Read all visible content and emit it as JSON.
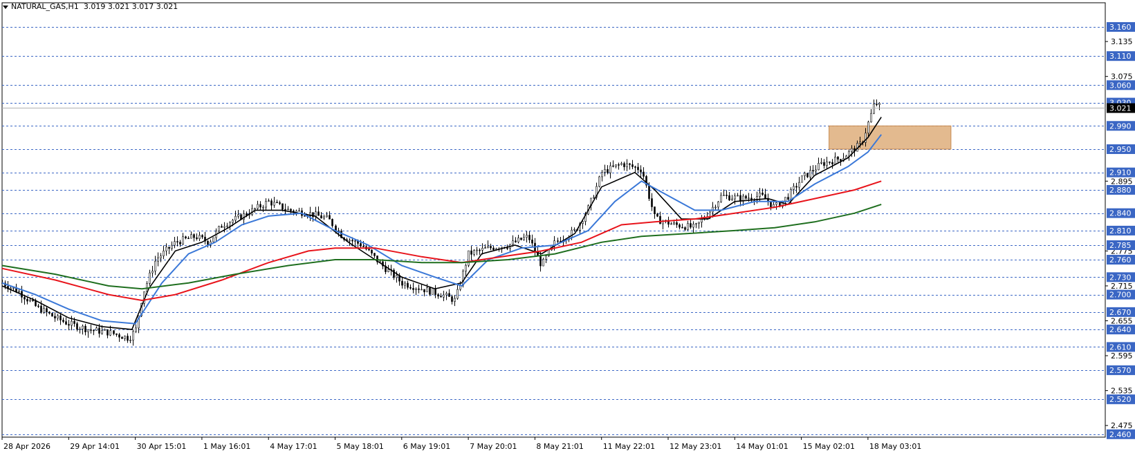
{
  "title": {
    "symbol": "NATURAL_GAS,H1",
    "ohlc": "3.019 3.021 3.017 3.021"
  },
  "colors": {
    "background": "#ffffff",
    "grid_dashed": "#3a66c4",
    "label_bg": "#3a66c4",
    "label_text": "#ffffff",
    "candle": "#000000",
    "ma_black": "#000000",
    "ma_blue": "#3a78d8",
    "ma_red": "#e8141b",
    "ma_green": "#1e6e1e",
    "zone": "#d9a36a"
  },
  "chart_data": {
    "type": "line",
    "title": "NATURAL_GAS,H1",
    "ylim": [
      2.455,
      3.185
    ],
    "current_price": "3.021",
    "price_ticks": [
      "3.135",
      "3.075",
      "2.895",
      "2.775",
      "2.715",
      "2.655",
      "2.595",
      "2.535",
      "2.475"
    ],
    "highlighted_levels": [
      "3.160",
      "3.110",
      "3.060",
      "3.030",
      "2.990",
      "2.950",
      "2.910",
      "2.880",
      "2.840",
      "2.810",
      "2.785",
      "2.760",
      "2.730",
      "2.700",
      "2.670",
      "2.640",
      "2.610",
      "2.570",
      "2.520",
      "2.460"
    ],
    "x_labels": [
      "28 Apr 2026",
      "29 Apr 14:01",
      "30 Apr 15:01",
      "1 May 16:01",
      "4 May 17:01",
      "5 May 18:01",
      "6 May 19:01",
      "7 May 20:01",
      "8 May 21:01",
      "11 May 22:01",
      "12 May 23:01",
      "14 May 01:01",
      "15 May 02:01",
      "18 May 03:01"
    ],
    "zone": {
      "from_label": "15 May 02:01",
      "to_label": "18 May 03:01",
      "low": 2.95,
      "high": 2.99
    },
    "close_points": [
      {
        "t": 0,
        "v": 2.72
      },
      {
        "t": 0.25,
        "v": 2.705
      },
      {
        "t": 0.5,
        "v": 2.68
      },
      {
        "t": 0.8,
        "v": 2.66
      },
      {
        "t": 1.0,
        "v": 2.65
      },
      {
        "t": 1.3,
        "v": 2.64
      },
      {
        "t": 1.6,
        "v": 2.635
      },
      {
        "t": 1.9,
        "v": 2.625
      },
      {
        "t": 2.0,
        "v": 2.64
      },
      {
        "t": 2.1,
        "v": 2.7
      },
      {
        "t": 2.3,
        "v": 2.76
      },
      {
        "t": 2.6,
        "v": 2.79
      },
      {
        "t": 2.9,
        "v": 2.8
      },
      {
        "t": 3.1,
        "v": 2.79
      },
      {
        "t": 3.3,
        "v": 2.82
      },
      {
        "t": 3.6,
        "v": 2.835
      },
      {
        "t": 4.0,
        "v": 2.86
      },
      {
        "t": 4.3,
        "v": 2.845
      },
      {
        "t": 4.6,
        "v": 2.84
      },
      {
        "t": 4.9,
        "v": 2.83
      },
      {
        "t": 5.1,
        "v": 2.8
      },
      {
        "t": 5.4,
        "v": 2.785
      },
      {
        "t": 5.7,
        "v": 2.75
      },
      {
        "t": 6.0,
        "v": 2.72
      },
      {
        "t": 6.3,
        "v": 2.71
      },
      {
        "t": 6.6,
        "v": 2.7
      },
      {
        "t": 6.8,
        "v": 2.69
      },
      {
        "t": 7.0,
        "v": 2.77
      },
      {
        "t": 7.3,
        "v": 2.78
      },
      {
        "t": 7.6,
        "v": 2.785
      },
      {
        "t": 7.9,
        "v": 2.8
      },
      {
        "t": 8.1,
        "v": 2.75
      },
      {
        "t": 8.3,
        "v": 2.79
      },
      {
        "t": 8.6,
        "v": 2.81
      },
      {
        "t": 8.8,
        "v": 2.85
      },
      {
        "t": 9.0,
        "v": 2.91
      },
      {
        "t": 9.3,
        "v": 2.925
      },
      {
        "t": 9.6,
        "v": 2.915
      },
      {
        "t": 9.8,
        "v": 2.83
      },
      {
        "t": 10.1,
        "v": 2.82
      },
      {
        "t": 10.4,
        "v": 2.815
      },
      {
        "t": 10.6,
        "v": 2.84
      },
      {
        "t": 10.8,
        "v": 2.87
      },
      {
        "t": 11.1,
        "v": 2.865
      },
      {
        "t": 11.4,
        "v": 2.87
      },
      {
        "t": 11.6,
        "v": 2.85
      },
      {
        "t": 11.8,
        "v": 2.87
      },
      {
        "t": 12.0,
        "v": 2.9
      },
      {
        "t": 12.3,
        "v": 2.925
      },
      {
        "t": 12.6,
        "v": 2.935
      },
      {
        "t": 12.9,
        "v": 2.96
      },
      {
        "t": 13.1,
        "v": 3.03
      },
      {
        "t": 13.2,
        "v": 3.021
      }
    ],
    "series": [
      {
        "color": "#000000",
        "points": [
          {
            "t": 0,
            "v": 2.715
          },
          {
            "t": 0.5,
            "v": 2.69
          },
          {
            "t": 1.0,
            "v": 2.66
          },
          {
            "t": 1.5,
            "v": 2.645
          },
          {
            "t": 1.95,
            "v": 2.64
          },
          {
            "t": 2.2,
            "v": 2.71
          },
          {
            "t": 2.6,
            "v": 2.775
          },
          {
            "t": 3.0,
            "v": 2.79
          },
          {
            "t": 3.4,
            "v": 2.815
          },
          {
            "t": 3.8,
            "v": 2.845
          },
          {
            "t": 4.2,
            "v": 2.845
          },
          {
            "t": 4.7,
            "v": 2.835
          },
          {
            "t": 5.2,
            "v": 2.79
          },
          {
            "t": 5.6,
            "v": 2.76
          },
          {
            "t": 6.0,
            "v": 2.73
          },
          {
            "t": 6.5,
            "v": 2.71
          },
          {
            "t": 6.9,
            "v": 2.72
          },
          {
            "t": 7.2,
            "v": 2.77
          },
          {
            "t": 7.7,
            "v": 2.785
          },
          {
            "t": 8.1,
            "v": 2.77
          },
          {
            "t": 8.6,
            "v": 2.805
          },
          {
            "t": 9.0,
            "v": 2.885
          },
          {
            "t": 9.5,
            "v": 2.91
          },
          {
            "t": 9.8,
            "v": 2.88
          },
          {
            "t": 10.2,
            "v": 2.83
          },
          {
            "t": 10.6,
            "v": 2.83
          },
          {
            "t": 11.0,
            "v": 2.86
          },
          {
            "t": 11.5,
            "v": 2.865
          },
          {
            "t": 11.8,
            "v": 2.855
          },
          {
            "t": 12.2,
            "v": 2.905
          },
          {
            "t": 12.7,
            "v": 2.935
          },
          {
            "t": 13.0,
            "v": 2.97
          },
          {
            "t": 13.2,
            "v": 3.005
          }
        ]
      },
      {
        "color": "#3a78d8",
        "points": [
          {
            "t": 0,
            "v": 2.72
          },
          {
            "t": 0.5,
            "v": 2.7
          },
          {
            "t": 1.0,
            "v": 2.675
          },
          {
            "t": 1.5,
            "v": 2.655
          },
          {
            "t": 2.0,
            "v": 2.65
          },
          {
            "t": 2.4,
            "v": 2.72
          },
          {
            "t": 2.8,
            "v": 2.77
          },
          {
            "t": 3.2,
            "v": 2.79
          },
          {
            "t": 3.6,
            "v": 2.82
          },
          {
            "t": 4.0,
            "v": 2.835
          },
          {
            "t": 4.5,
            "v": 2.84
          },
          {
            "t": 5.0,
            "v": 2.81
          },
          {
            "t": 5.5,
            "v": 2.785
          },
          {
            "t": 6.0,
            "v": 2.75
          },
          {
            "t": 6.5,
            "v": 2.73
          },
          {
            "t": 6.9,
            "v": 2.715
          },
          {
            "t": 7.3,
            "v": 2.76
          },
          {
            "t": 7.8,
            "v": 2.78
          },
          {
            "t": 8.3,
            "v": 2.785
          },
          {
            "t": 8.8,
            "v": 2.81
          },
          {
            "t": 9.2,
            "v": 2.86
          },
          {
            "t": 9.6,
            "v": 2.895
          },
          {
            "t": 10.0,
            "v": 2.87
          },
          {
            "t": 10.4,
            "v": 2.845
          },
          {
            "t": 10.8,
            "v": 2.845
          },
          {
            "t": 11.3,
            "v": 2.86
          },
          {
            "t": 11.8,
            "v": 2.86
          },
          {
            "t": 12.2,
            "v": 2.89
          },
          {
            "t": 12.7,
            "v": 2.92
          },
          {
            "t": 13.0,
            "v": 2.945
          },
          {
            "t": 13.2,
            "v": 2.975
          }
        ]
      },
      {
        "color": "#e8141b",
        "points": [
          {
            "t": 0,
            "v": 2.745
          },
          {
            "t": 0.8,
            "v": 2.725
          },
          {
            "t": 1.6,
            "v": 2.7
          },
          {
            "t": 2.1,
            "v": 2.69
          },
          {
            "t": 2.6,
            "v": 2.7
          },
          {
            "t": 3.3,
            "v": 2.725
          },
          {
            "t": 4.0,
            "v": 2.755
          },
          {
            "t": 4.6,
            "v": 2.775
          },
          {
            "t": 5.0,
            "v": 2.78
          },
          {
            "t": 5.6,
            "v": 2.78
          },
          {
            "t": 6.3,
            "v": 2.765
          },
          {
            "t": 6.9,
            "v": 2.755
          },
          {
            "t": 7.5,
            "v": 2.765
          },
          {
            "t": 8.1,
            "v": 2.775
          },
          {
            "t": 8.7,
            "v": 2.79
          },
          {
            "t": 9.3,
            "v": 2.82
          },
          {
            "t": 9.8,
            "v": 2.825
          },
          {
            "t": 10.4,
            "v": 2.83
          },
          {
            "t": 11.0,
            "v": 2.84
          },
          {
            "t": 11.6,
            "v": 2.85
          },
          {
            "t": 12.2,
            "v": 2.865
          },
          {
            "t": 12.8,
            "v": 2.88
          },
          {
            "t": 13.2,
            "v": 2.895
          }
        ]
      },
      {
        "color": "#1e6e1e",
        "points": [
          {
            "t": 0,
            "v": 2.75
          },
          {
            "t": 0.8,
            "v": 2.735
          },
          {
            "t": 1.6,
            "v": 2.715
          },
          {
            "t": 2.1,
            "v": 2.71
          },
          {
            "t": 2.8,
            "v": 2.72
          },
          {
            "t": 3.5,
            "v": 2.735
          },
          {
            "t": 4.3,
            "v": 2.75
          },
          {
            "t": 5.0,
            "v": 2.76
          },
          {
            "t": 5.6,
            "v": 2.76
          },
          {
            "t": 6.3,
            "v": 2.755
          },
          {
            "t": 6.9,
            "v": 2.755
          },
          {
            "t": 7.6,
            "v": 2.76
          },
          {
            "t": 8.3,
            "v": 2.77
          },
          {
            "t": 9.0,
            "v": 2.79
          },
          {
            "t": 9.6,
            "v": 2.8
          },
          {
            "t": 10.3,
            "v": 2.805
          },
          {
            "t": 11.0,
            "v": 2.81
          },
          {
            "t": 11.6,
            "v": 2.815
          },
          {
            "t": 12.2,
            "v": 2.825
          },
          {
            "t": 12.8,
            "v": 2.84
          },
          {
            "t": 13.2,
            "v": 2.855
          }
        ]
      }
    ]
  }
}
